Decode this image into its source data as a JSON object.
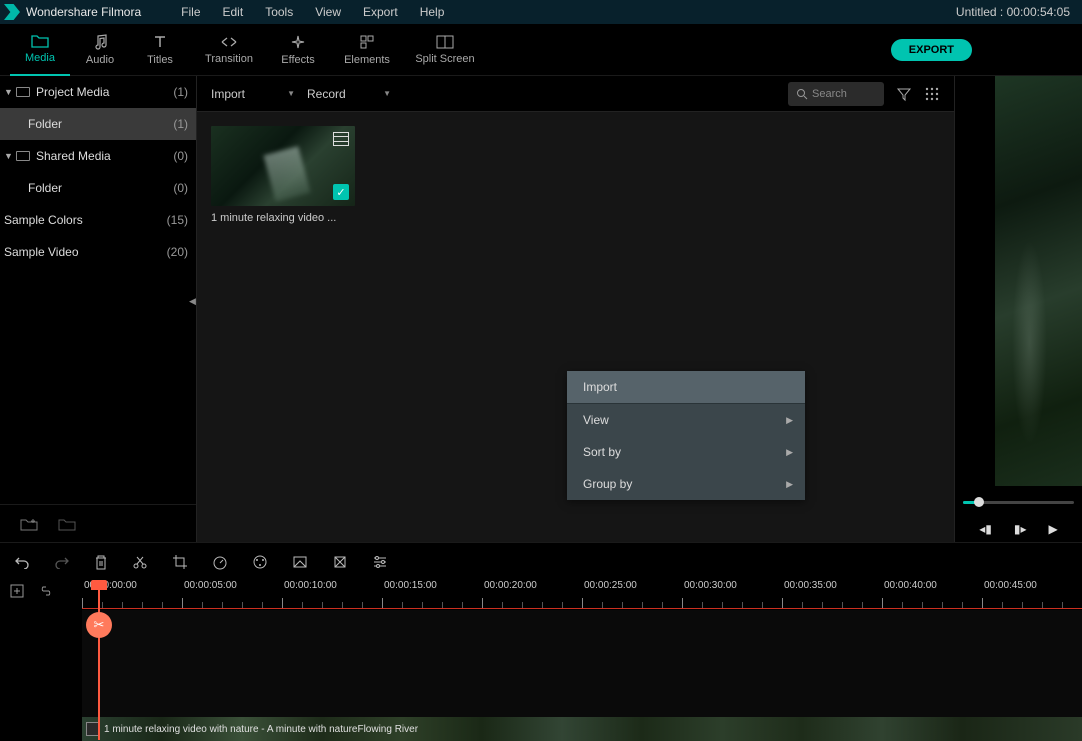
{
  "app": {
    "name": "Wondershare Filmora",
    "title_right": "Untitled : 00:00:54:05"
  },
  "menu": {
    "file": "File",
    "edit": "Edit",
    "tools": "Tools",
    "view": "View",
    "export": "Export",
    "help": "Help"
  },
  "tabs": {
    "media": "Media",
    "audio": "Audio",
    "titles": "Titles",
    "transition": "Transition",
    "effects": "Effects",
    "elements": "Elements",
    "split_screen": "Split Screen"
  },
  "export_btn": "EXPORT",
  "sidebar": {
    "project_media": {
      "label": "Project Media",
      "count": "(1)"
    },
    "folder1": {
      "label": "Folder",
      "count": "(1)"
    },
    "shared_media": {
      "label": "Shared Media",
      "count": "(0)"
    },
    "folder2": {
      "label": "Folder",
      "count": "(0)"
    },
    "sample_colors": {
      "label": "Sample Colors",
      "count": "(15)"
    },
    "sample_video": {
      "label": "Sample Video",
      "count": "(20)"
    }
  },
  "media_toolbar": {
    "import": "Import",
    "record": "Record",
    "search_placeholder": "Search"
  },
  "media_items": {
    "item0": {
      "caption": "1 minute relaxing video ..."
    }
  },
  "context_menu": {
    "import": "Import",
    "view": "View",
    "sort_by": "Sort by",
    "group_by": "Group by"
  },
  "timeline": {
    "ticks": [
      "00:00:00:00",
      "00:00:05:00",
      "00:00:10:00",
      "00:00:15:00",
      "00:00:20:00",
      "00:00:25:00",
      "00:00:30:00",
      "00:00:35:00",
      "00:00:40:00",
      "00:00:45:00"
    ],
    "clip_label": "1 minute relaxing video with nature - A minute with natureFlowing River"
  }
}
